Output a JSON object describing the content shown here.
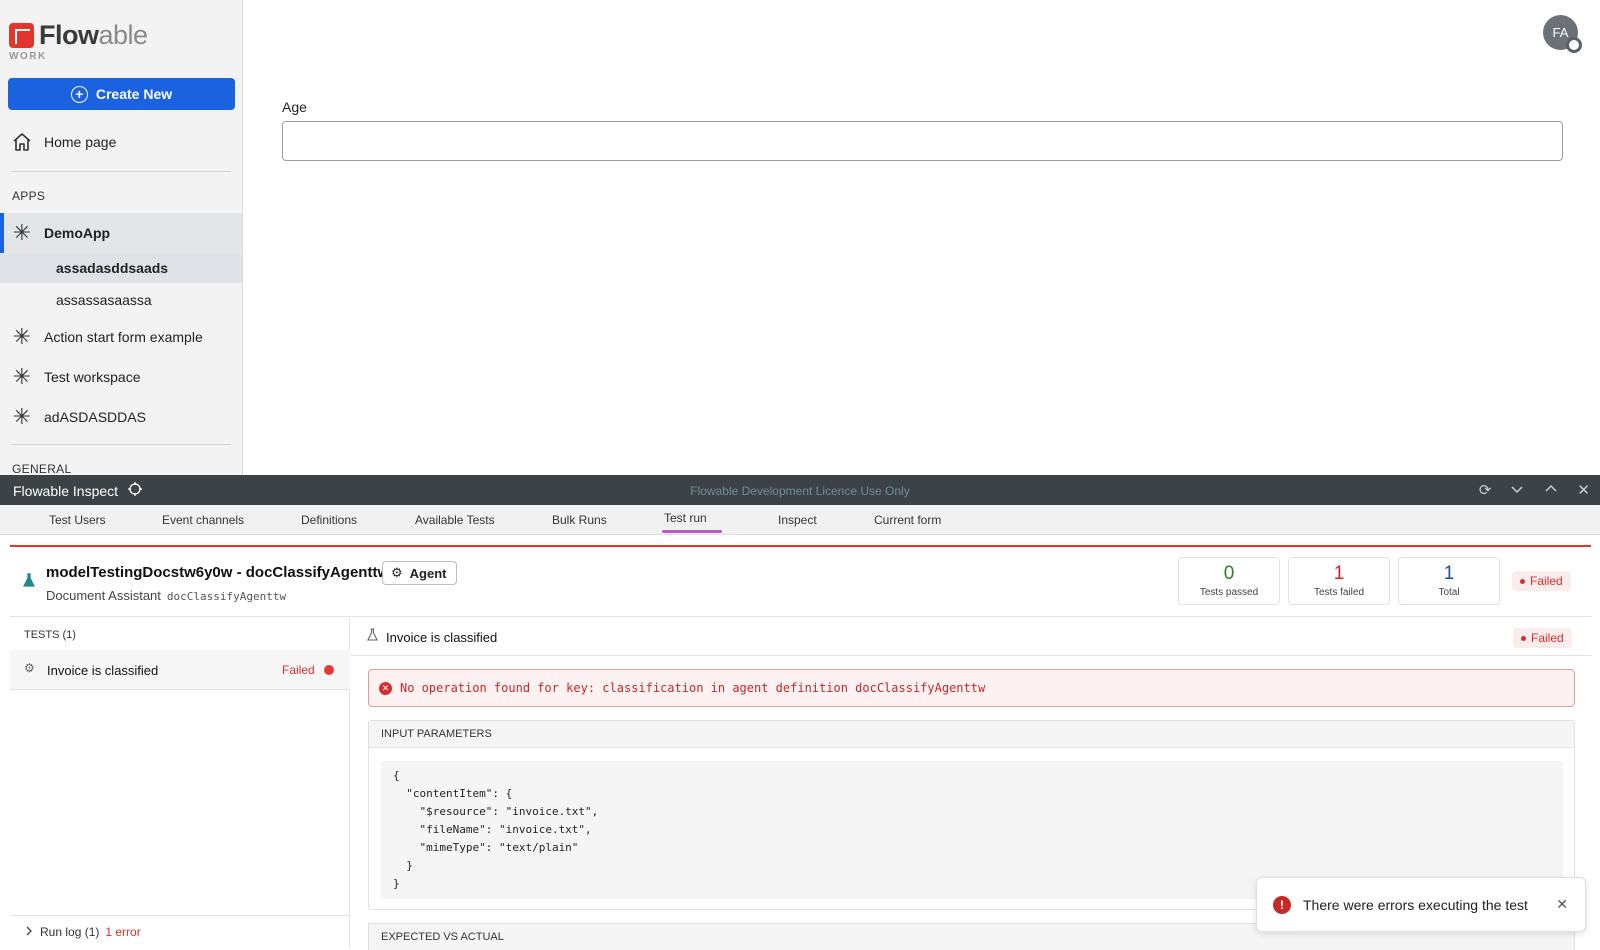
{
  "sidebar": {
    "logo_text_main": "Flow",
    "logo_text_thin": "able",
    "logo_sub": "WORK",
    "create_label": "Create New",
    "home_label": "Home page",
    "apps_label": "APPS",
    "apps": [
      {
        "label": "DemoApp",
        "icon": "asterisk-icon"
      },
      {
        "label": "Action start form example",
        "icon": "asterisk-icon"
      },
      {
        "label": "Test workspace",
        "icon": "asterisk-icon"
      },
      {
        "label": "adASDASDDAS",
        "icon": "asterisk-icon"
      }
    ],
    "subitems": [
      "assadasddsaads",
      "assassasaassa"
    ],
    "general_label": "GENERAL"
  },
  "header": {
    "avatar_initials": "FA"
  },
  "form": {
    "age_label": "Age",
    "age_value": ""
  },
  "inspect": {
    "title": "Flowable Inspect",
    "licence": "Flowable Development Licence Use Only",
    "tabs": [
      "Test Users",
      "Event channels",
      "Definitions",
      "Available Tests",
      "Bulk Runs",
      "Test run",
      "Inspect",
      "Current form"
    ],
    "active_tab": "Test run"
  },
  "run": {
    "title": "modelTestingDocstw6y0w - docClassifyAgenttw",
    "badge": "Agent",
    "subtitle": "Document Assistant",
    "subtitle_key": "docClassifyAgenttw",
    "stats": {
      "passed": {
        "value": "0",
        "label": "Tests passed",
        "color": "#2e7d32"
      },
      "failed": {
        "value": "1",
        "label": "Tests failed",
        "color": "#c62828"
      },
      "total": {
        "value": "1",
        "label": "Total",
        "color": "#1b4fa0"
      }
    },
    "status": "Failed",
    "tests_header": "TESTS (1)",
    "tests": [
      {
        "name": "Invoice is classified",
        "status": "Failed"
      }
    ],
    "runlog": "Run log (1)",
    "runlog_errors": "1 error",
    "detail_title": "Invoice is classified",
    "detail_status": "Failed",
    "error_message": "No operation found for key: classification in agent definition docClassifyAgenttw",
    "input_params_label": "INPUT PARAMETERS",
    "input_params_code": "{\n  \"contentItem\": {\n    \"$resource\": \"invoice.txt\",\n    \"fileName\": \"invoice.txt\",\n    \"mimeType\": \"text/plain\"\n  }\n}",
    "expected_label": "EXPECTED VS ACTUAL"
  },
  "toast": {
    "message": "There were errors executing the test"
  },
  "colors": {
    "brand": "#1b62e0",
    "error": "#d32f2f",
    "logo_red": "#e0362c"
  }
}
